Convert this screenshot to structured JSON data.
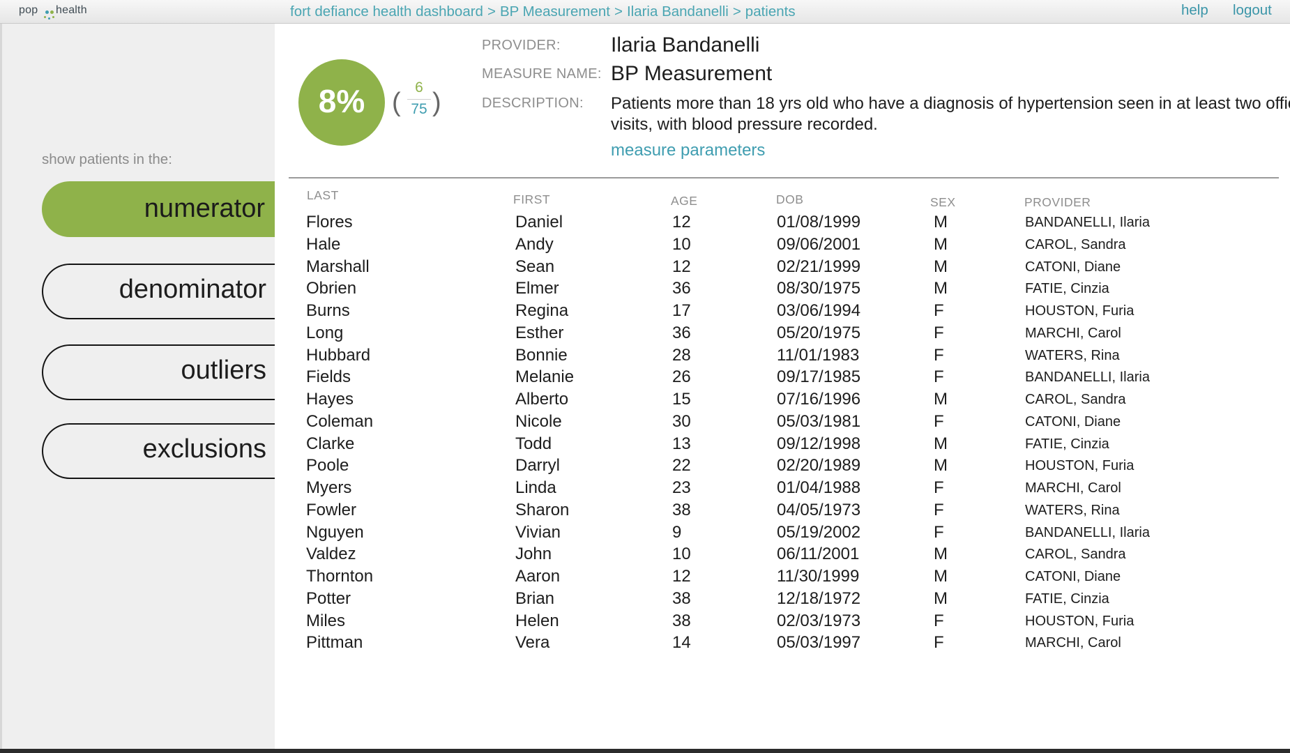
{
  "brand": {
    "logo_left": "pop",
    "logo_right": "health"
  },
  "breadcrumb": [
    "fort defiance health dashboard",
    "BP Measurement",
    "Ilaria Bandanelli",
    "patients"
  ],
  "breadcrumb_separator": ">",
  "nav": {
    "help": "help",
    "logout": "logout"
  },
  "sidebar": {
    "caption": "show patients in the:",
    "filters": [
      {
        "label": "numerator",
        "active": true
      },
      {
        "label": "denominator",
        "active": false
      },
      {
        "label": "outliers",
        "active": false
      },
      {
        "label": "exclusions",
        "active": false
      }
    ]
  },
  "measure": {
    "percent": "8%",
    "numerator": "6",
    "denominator": "75",
    "open_paren": "(",
    "close_paren": ")",
    "provider_label": "PROVIDER:",
    "provider": "Ilaria Bandanelli",
    "name_label": "MEASURE NAME:",
    "name": "BP Measurement",
    "description_label": "DESCRIPTION:",
    "description": "Patients more than 18 yrs old who have a diagnosis of hypertension seen in at least two office visits, with blood pressure recorded.",
    "parameters_link": "measure parameters"
  },
  "table": {
    "headers": [
      "LAST",
      "FIRST",
      "AGE",
      "DOB",
      "SEX",
      "PROVIDER"
    ],
    "rows": [
      [
        "Flores",
        "Daniel",
        "12",
        "01/08/1999",
        "M",
        "BANDANELLI, Ilaria"
      ],
      [
        "Hale",
        "Andy",
        "10",
        "09/06/2001",
        "M",
        "CAROL, Sandra"
      ],
      [
        "Marshall",
        "Sean",
        "12",
        "02/21/1999",
        "M",
        "CATONI, Diane"
      ],
      [
        "Obrien",
        "Elmer",
        "36",
        "08/30/1975",
        "M",
        "FATIE, Cinzia"
      ],
      [
        "Burns",
        "Regina",
        "17",
        "03/06/1994",
        "F",
        "HOUSTON, Furia"
      ],
      [
        "Long",
        "Esther",
        "36",
        "05/20/1975",
        "F",
        "MARCHI, Carol"
      ],
      [
        "Hubbard",
        "Bonnie",
        "28",
        "11/01/1983",
        "F",
        "WATERS, Rina"
      ],
      [
        "Fields",
        "Melanie",
        "26",
        "09/17/1985",
        "F",
        "BANDANELLI, Ilaria"
      ],
      [
        "Hayes",
        "Alberto",
        "15",
        "07/16/1996",
        "M",
        "CAROL, Sandra"
      ],
      [
        "Coleman",
        "Nicole",
        "30",
        "05/03/1981",
        "F",
        "CATONI, Diane"
      ],
      [
        "Clarke",
        "Todd",
        "13",
        "09/12/1998",
        "M",
        "FATIE, Cinzia"
      ],
      [
        "Poole",
        "Darryl",
        "22",
        "02/20/1989",
        "M",
        "HOUSTON, Furia"
      ],
      [
        "Myers",
        "Linda",
        "23",
        "01/04/1988",
        "F",
        "MARCHI, Carol"
      ],
      [
        "Fowler",
        "Sharon",
        "38",
        "04/05/1973",
        "F",
        "WATERS, Rina"
      ],
      [
        "Nguyen",
        "Vivian",
        "9",
        "05/19/2002",
        "F",
        "BANDANELLI, Ilaria"
      ],
      [
        "Valdez",
        "John",
        "10",
        "06/11/2001",
        "M",
        "CAROL, Sandra"
      ],
      [
        "Thornton",
        "Aaron",
        "12",
        "11/30/1999",
        "M",
        "CATONI, Diane"
      ],
      [
        "Potter",
        "Brian",
        "38",
        "12/18/1972",
        "M",
        "FATIE, Cinzia"
      ],
      [
        "Miles",
        "Helen",
        "38",
        "02/03/1973",
        "F",
        "HOUSTON, Furia"
      ],
      [
        "Pittman",
        "Vera",
        "14",
        "05/03/1997",
        "F",
        "MARCHI, Carol"
      ]
    ]
  },
  "colors": {
    "accent_green": "#8fb24a",
    "link_teal": "#4aa5b2",
    "denominator_teal": "#3f9db0"
  }
}
